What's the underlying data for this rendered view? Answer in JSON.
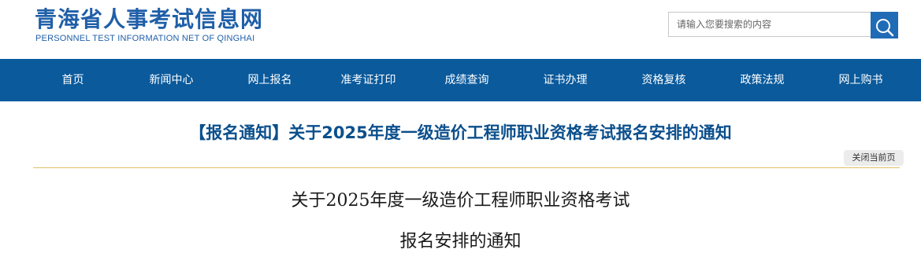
{
  "header": {
    "logo_cn": "青海省人事考试信息网",
    "logo_en": "PERSONNEL TEST INFORMATION NET OF QINGHAI",
    "search": {
      "placeholder": "请输入您要搜索的内容",
      "value": "",
      "button_icon": "search-icon"
    }
  },
  "nav": {
    "items": [
      {
        "label": "首页"
      },
      {
        "label": "新闻中心"
      },
      {
        "label": "网上报名"
      },
      {
        "label": "准考证打印"
      },
      {
        "label": "成绩查询"
      },
      {
        "label": "证书办理"
      },
      {
        "label": "资格复核"
      },
      {
        "label": "政策法规"
      },
      {
        "label": "网上购书"
      }
    ]
  },
  "article": {
    "title": "【报名通知】关于2025年度一级造价工程师职业资格考试报名安排的通知",
    "close_label": "关闭当前页",
    "heading_line1": "关于2025年度一级造价工程师职业资格考试",
    "heading_line2": "报名安排的通知"
  },
  "colors": {
    "brand_blue": "#1f5fa8",
    "nav_bg": "#0a5a9c",
    "title_blue": "#0b4f8c",
    "rule_gold": "#e0c06a"
  }
}
